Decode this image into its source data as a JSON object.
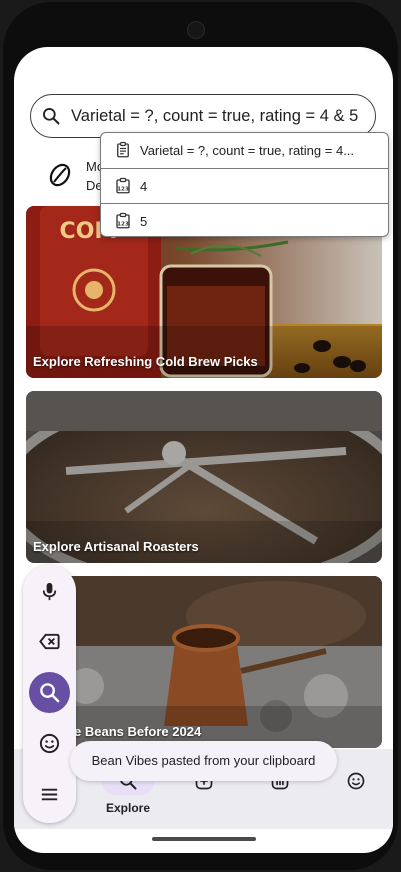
{
  "search": {
    "query": "Varietal = ?, count = true, rating = 4 & 5"
  },
  "dropdown": {
    "items": [
      {
        "label": "Varietal = ?, count = true, rating = 4..."
      },
      {
        "label": "4"
      },
      {
        "label": "5"
      }
    ]
  },
  "category": {
    "line1": "Mo",
    "line2": "De"
  },
  "cards": [
    {
      "caption": "Explore Refreshing Cold Brew Picks"
    },
    {
      "caption": "Explore Artisanal Roasters"
    },
    {
      "caption": "e Beans Before 2024"
    }
  ],
  "nav": {
    "explore_label": "Explore"
  },
  "toast": {
    "message": "Bean Vibes pasted from your clipboard"
  },
  "colors": {
    "accent": "#6750a4",
    "nav_pill": "#e8def8",
    "navbar": "#ecebf0"
  }
}
